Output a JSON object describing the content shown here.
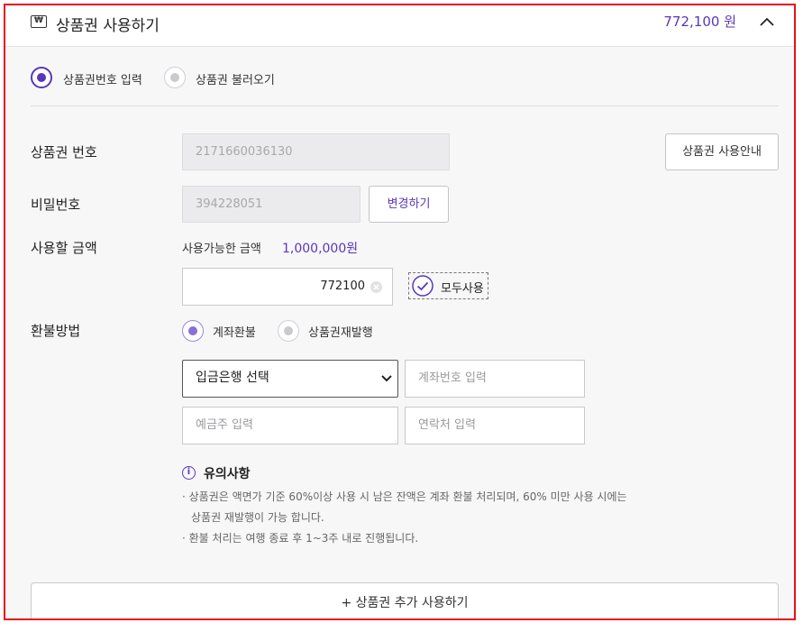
{
  "header": {
    "title": "상품권 사용하기",
    "total_amount": "772,100 원"
  },
  "mode": {
    "option_input": "상품권번호 입력",
    "option_load": "상품권 불러오기",
    "selected": "상품권번호 입력"
  },
  "voucher": {
    "number_label": "상품권 번호",
    "number_value": "2171660036130",
    "guide_button": "상품권 사용안내",
    "password_label": "비밀번호",
    "password_value": "394228051",
    "change_button": "변경하기",
    "amount_label": "사용할 금액",
    "available_label": "사용가능한 금액",
    "available_value": "1,000,000원",
    "amount_value": "772100",
    "use_all_label": "모두사용"
  },
  "refund": {
    "label": "환불방법",
    "option_account": "계좌환불",
    "option_reissue": "상품권재발행",
    "selected": "계좌환불",
    "bank_select": "입금은행 선택",
    "account_placeholder": "계좌번호 입력",
    "holder_placeholder": "예금주 입력",
    "contact_placeholder": "연락처 입력"
  },
  "notice": {
    "title": "유의사항",
    "lines": [
      "· 상품권은 액면가 기준 60%이상 사용 시 남은 잔액은 계좌 환불 처리되며, 60% 미만 사용 시에는",
      "상품권 재발행이 가능 합니다.",
      "· 환불 처리는 여행 종료 후 1~3주 내로 진행됩니다."
    ]
  },
  "add_button": "+ 상품권 추가 사용하기",
  "colors": {
    "accent": "#5a37b8",
    "frame": "#e8101d"
  }
}
